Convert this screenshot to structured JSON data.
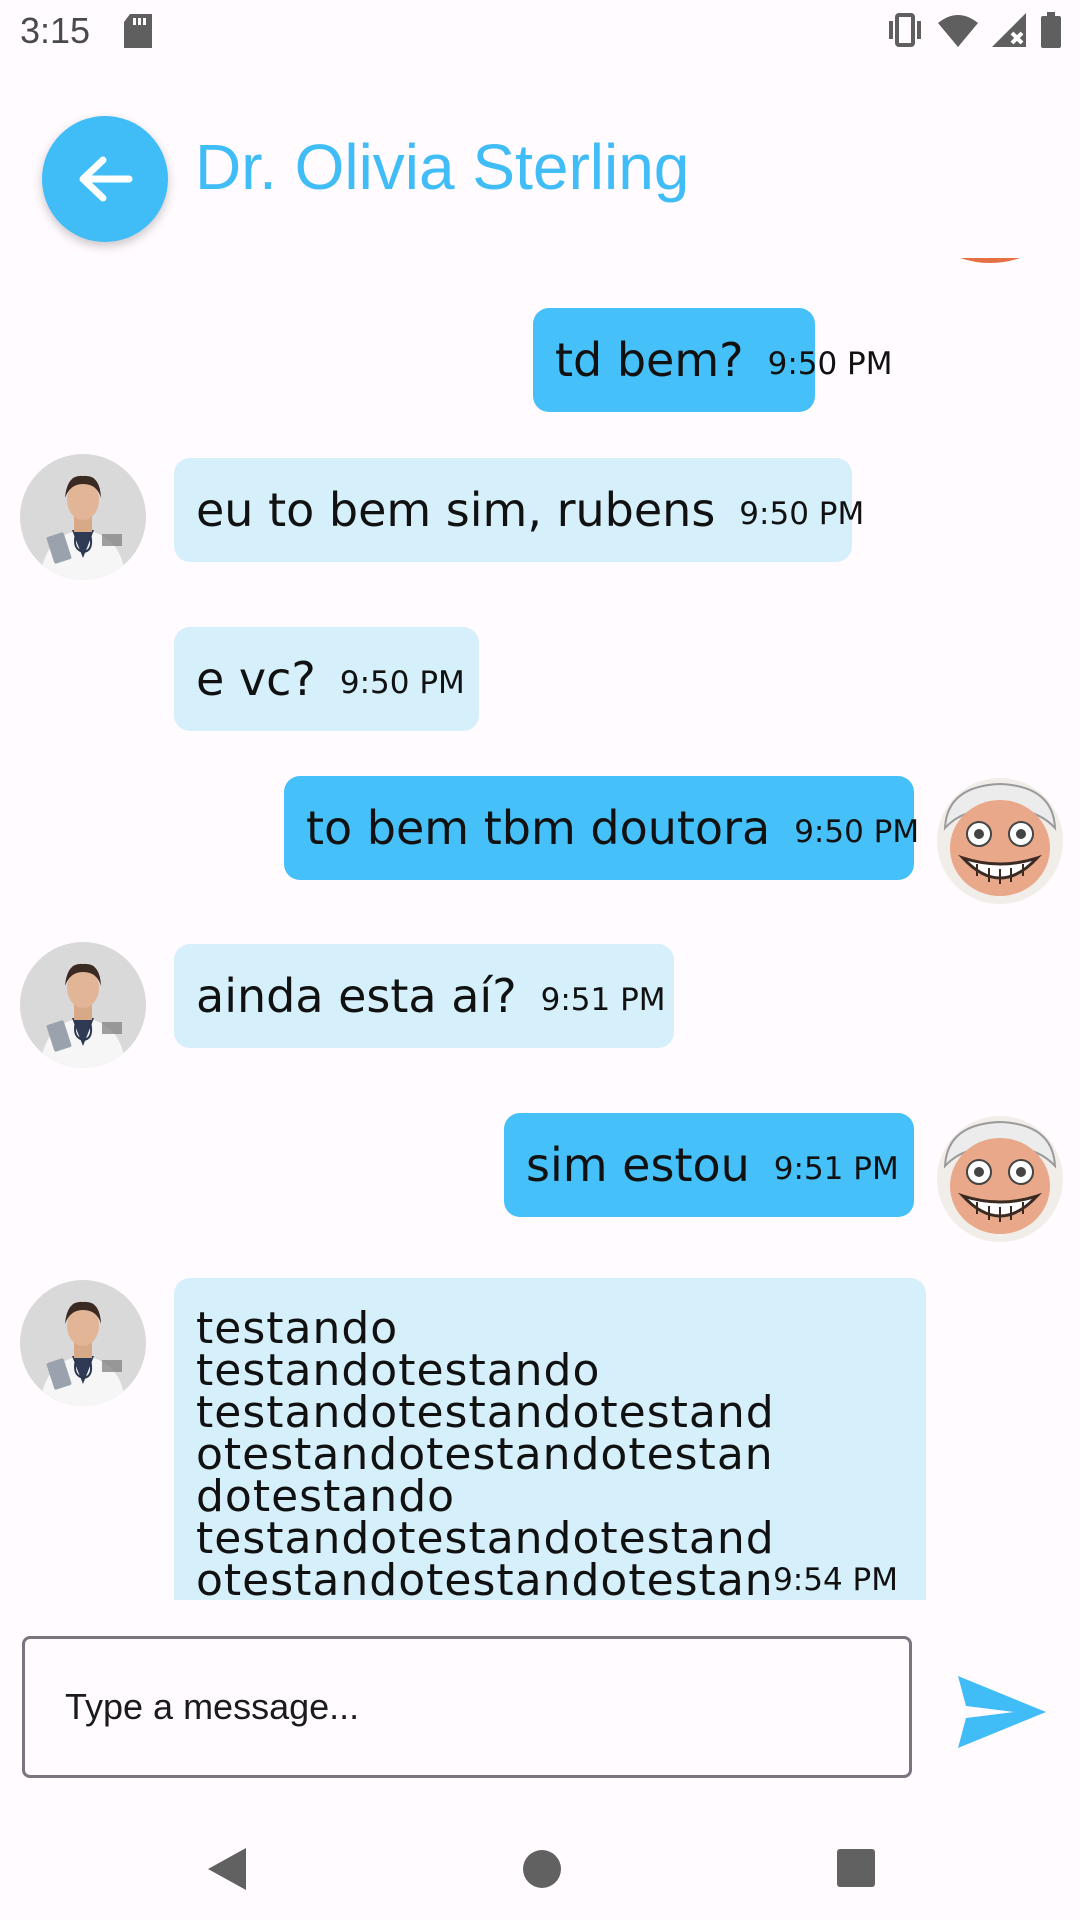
{
  "status_bar": {
    "time": "3:15",
    "icons": [
      "sd-card-icon",
      "vibrate-icon",
      "wifi-icon",
      "signal-no-data-icon",
      "battery-icon"
    ]
  },
  "header": {
    "back_icon": "arrow-left-icon",
    "title": "Dr. Olivia Sterling",
    "accent_color": "#40bdf7"
  },
  "messages": [
    {
      "sender": "me",
      "text": "td bem?",
      "time": "9:50 PM",
      "avatar": null
    },
    {
      "sender": "doctor",
      "text": "eu to bem sim, rubens",
      "time": "9:50 PM",
      "avatar": "doctor-avatar"
    },
    {
      "sender": "doctor",
      "text": "e vc?",
      "time": "9:50 PM",
      "avatar": null
    },
    {
      "sender": "me",
      "text": "to bem tbm doutora",
      "time": "9:50 PM",
      "avatar": "user-avatar"
    },
    {
      "sender": "doctor",
      "text": "ainda esta aí?",
      "time": "9:51 PM",
      "avatar": "doctor-avatar"
    },
    {
      "sender": "me",
      "text": "sim estou",
      "time": "9:51 PM",
      "avatar": "user-avatar"
    },
    {
      "sender": "doctor",
      "text": "testando\ntestandotestando\ntestandotestandotestand\notestandotestandotestan\ndotestando\ntestandotestandotestand\notestandotestandotestan",
      "time": "9:54 PM",
      "avatar": "doctor-avatar"
    }
  ],
  "composer": {
    "placeholder": "Type a message...",
    "send_icon": "send-icon"
  },
  "colors": {
    "sent_bubble": "#45c0f9",
    "received_bubble": "#d5effb",
    "background": "#fffbfe"
  },
  "nav_bar": {
    "icons": [
      "nav-back-icon",
      "nav-home-icon",
      "nav-recents-icon"
    ]
  }
}
